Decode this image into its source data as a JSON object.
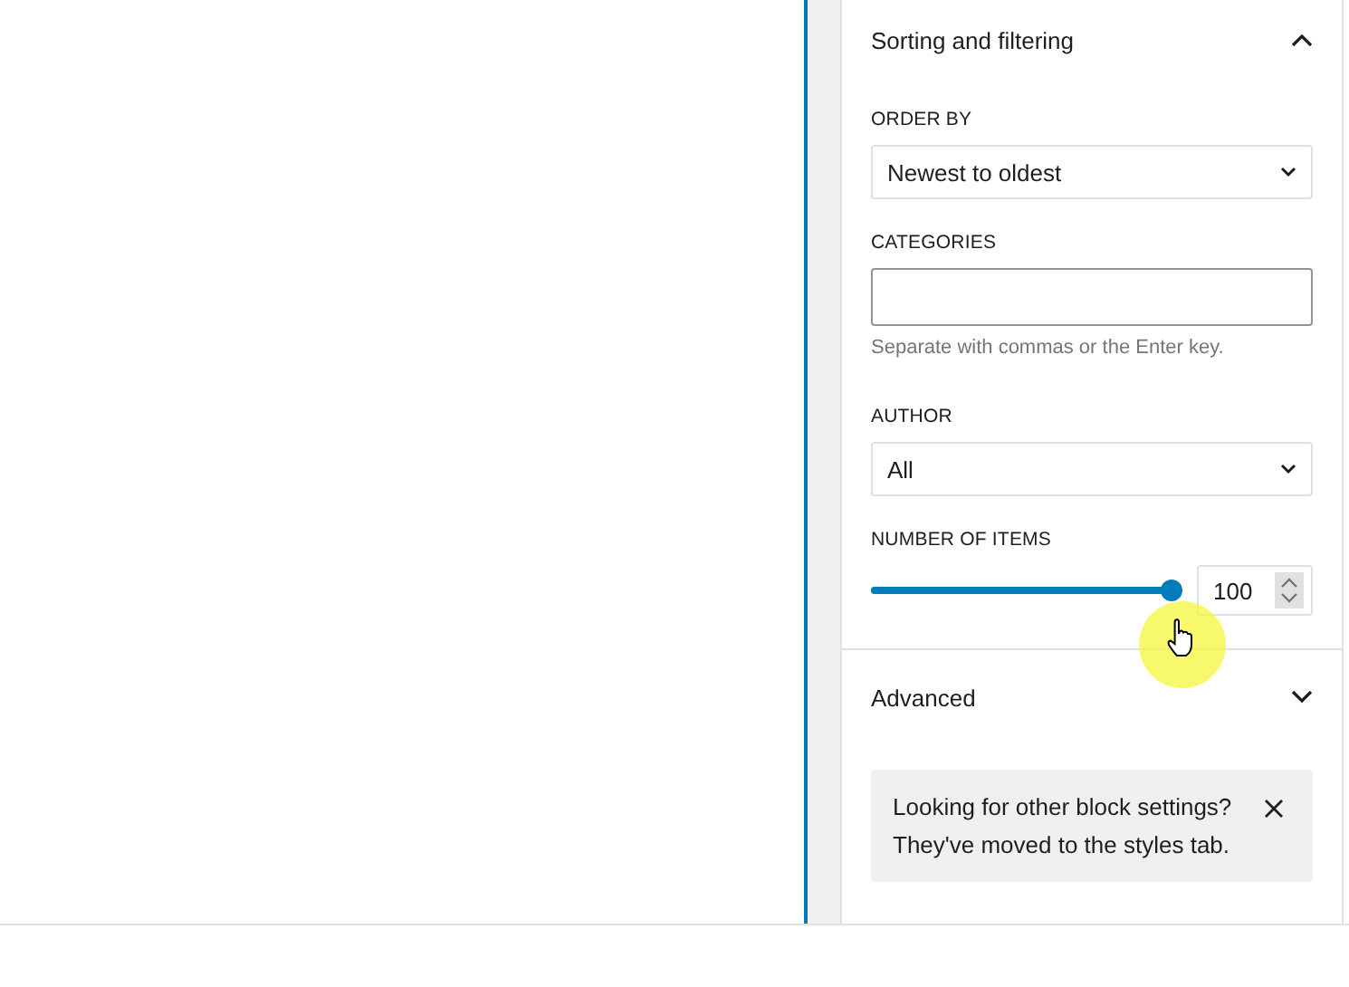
{
  "sections": [
    {
      "title": "Sorting and filtering",
      "expanded": true,
      "fields": [
        {
          "kind": "select",
          "label": "ORDER BY",
          "value": "Newest to oldest"
        },
        {
          "kind": "tokens",
          "label": "CATEGORIES",
          "help": "Separate with commas or the Enter key."
        },
        {
          "kind": "select",
          "label": "AUTHOR",
          "value": "All"
        },
        {
          "kind": "range",
          "label": "NUMBER OF ITEMS",
          "level": 1,
          "value": "100"
        }
      ]
    },
    {
      "title": "Advanced",
      "expanded": false
    }
  ],
  "notice": {
    "text": "Looking for other block settings? They've moved to the styles tab."
  }
}
